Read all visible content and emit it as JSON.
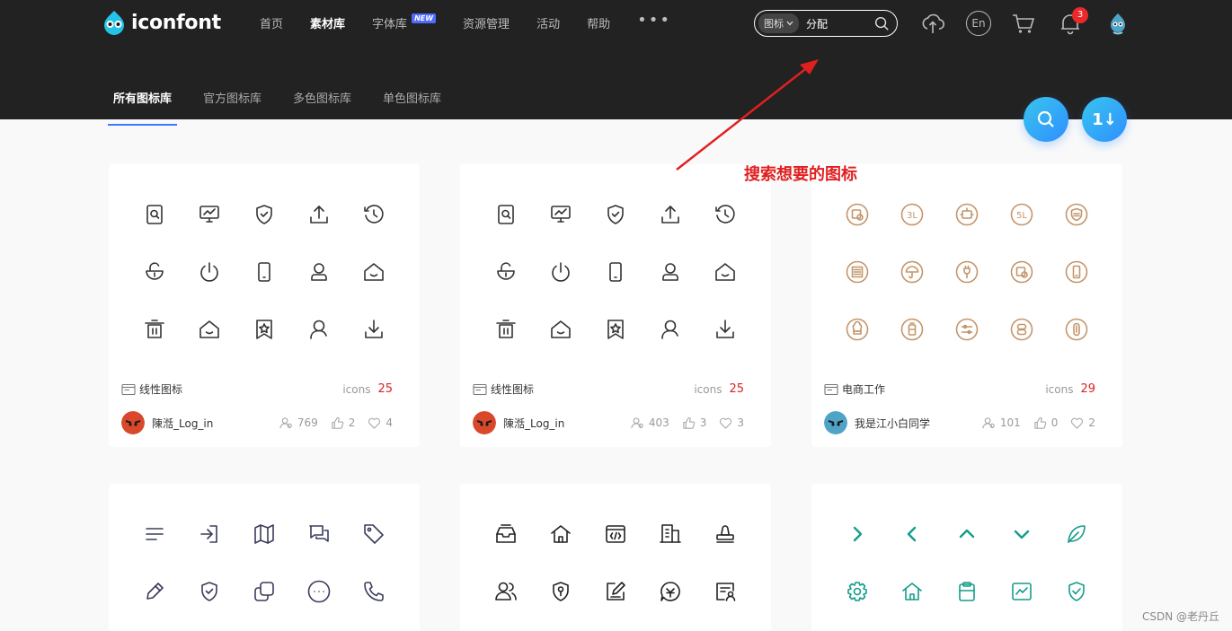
{
  "brand": {
    "logo_text": "iconfont"
  },
  "nav": {
    "items": [
      {
        "label": "首页",
        "active": false
      },
      {
        "label": "素材库",
        "active": true
      },
      {
        "label": "字体库",
        "active": false,
        "badge": "NEW"
      },
      {
        "label": "资源管理",
        "active": false
      },
      {
        "label": "活动",
        "active": false
      },
      {
        "label": "帮助",
        "active": false
      }
    ],
    "more": "•••"
  },
  "search": {
    "type_label": "图标",
    "value": "分配"
  },
  "header_icons": [
    "upload-cloud-icon",
    "language-en-icon",
    "cart-icon",
    "bell-icon",
    "user-avatar"
  ],
  "header_lang": "En",
  "notifications": {
    "count": "3"
  },
  "subnav": {
    "items": [
      {
        "label": "所有图标库",
        "active": true
      },
      {
        "label": "官方图标库",
        "active": false
      },
      {
        "label": "多色图标库",
        "active": false
      },
      {
        "label": "单色图标库",
        "active": false
      }
    ]
  },
  "fab": {
    "sort_label": "1↓"
  },
  "annotation": {
    "text": "搜索想要的图标",
    "color": "#e02020"
  },
  "cards": [
    {
      "name": "线性图标",
      "icons_label": "icons",
      "count": "25",
      "author": "陳湉_Log_in",
      "avatar_color": "#d9482b",
      "stats": {
        "views": "769",
        "likes": "2",
        "favorites": "4"
      },
      "icon_color": "#333333",
      "icons": [
        "search-doc",
        "monitor",
        "shield",
        "upload",
        "history",
        "unlock",
        "power",
        "phone",
        "user",
        "home-smile",
        "trash",
        "home-smile",
        "bookmark-star",
        "user-outline",
        "download"
      ]
    },
    {
      "name": "线性图标",
      "icons_label": "icons",
      "count": "25",
      "author": "陳湉_Log_in",
      "avatar_color": "#d9482b",
      "stats": {
        "views": "403",
        "likes": "3",
        "favorites": "3"
      },
      "icon_color": "#333333",
      "icons": [
        "search-doc",
        "monitor",
        "shield",
        "upload",
        "history",
        "unlock",
        "power",
        "phone",
        "user",
        "home-smile",
        "trash",
        "home-smile",
        "bookmark-star",
        "user-outline",
        "download"
      ]
    },
    {
      "name": "电商工作",
      "icons_label": "icons",
      "count": "29",
      "author": "我是江小白同学",
      "avatar_color": "#4fa3c7",
      "stats": {
        "views": "101",
        "likes": "0",
        "favorites": "2"
      },
      "icon_color": "#c4956a",
      "icons": [
        "circle-grid",
        "circle-3l",
        "circle-robot",
        "circle-5l",
        "circle-shield",
        "circle-list",
        "circle-umbrella",
        "circle-plug",
        "circle-grid",
        "circle-phone",
        "circle-chef",
        "circle-bottle",
        "circle-sliders",
        "circle-stack",
        "circle-tube"
      ]
    },
    {
      "name": "",
      "icons_label": "",
      "count": "",
      "author": "",
      "icon_color": "#3b3b5c",
      "icons": [
        "menu",
        "login",
        "map",
        "chat",
        "tag",
        "pencil",
        "shield",
        "copy",
        "more-circle",
        "phone-call"
      ]
    },
    {
      "name": "",
      "icons_label": "",
      "count": "",
      "author": "",
      "icon_color": "#222222",
      "icons": [
        "inbox",
        "home",
        "code-window",
        "building",
        "stamp",
        "users",
        "shield-key",
        "edit-box",
        "chat-bubble",
        "id-card"
      ]
    },
    {
      "name": "",
      "icons_label": "",
      "count": "",
      "author": "",
      "icon_color": "#159c8c",
      "icons": [
        "chevron-right",
        "chevron-left",
        "chevron-up",
        "chevron-down",
        "leaf",
        "gear",
        "home",
        "clipboard",
        "chart",
        "shield-check"
      ]
    }
  ],
  "watermark": "CSDN @老丹丘"
}
